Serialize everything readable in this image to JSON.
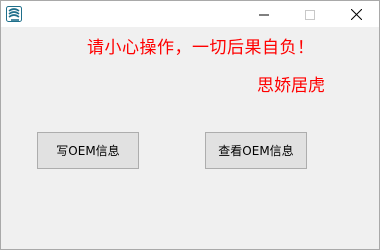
{
  "window": {
    "icon": "app-icon",
    "controls": [
      "minimize-icon",
      "maximize-icon",
      "close-icon"
    ]
  },
  "content": {
    "warning": "请小心操作，一切后果自负！",
    "author": "思娇居虎",
    "text_color": "#ff0000"
  },
  "buttons": {
    "write_oem_label": "写OEM信息",
    "view_oem_label": "查看OEM信息"
  }
}
